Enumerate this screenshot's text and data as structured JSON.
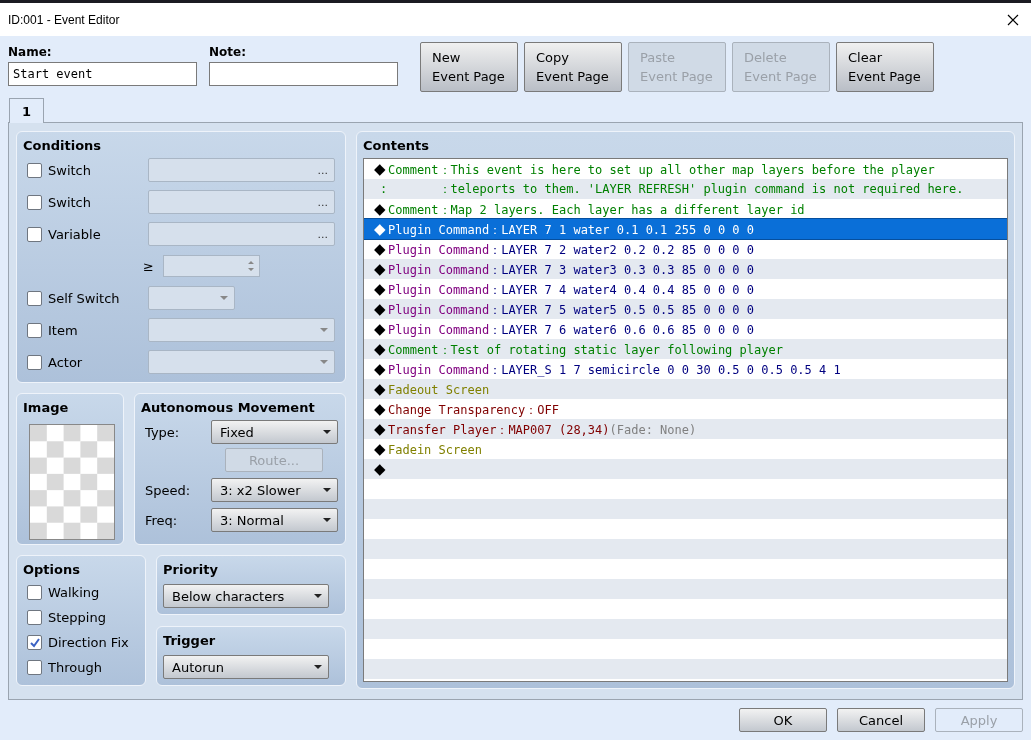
{
  "window": {
    "title": "ID:001 - Event Editor"
  },
  "name": {
    "label": "Name:",
    "value": "Start event"
  },
  "note": {
    "label": "Note:"
  },
  "page_buttons": [
    {
      "label": "New\nEvent Page",
      "disabled": false
    },
    {
      "label": "Copy\nEvent Page",
      "disabled": false
    },
    {
      "label": "Paste\nEvent Page",
      "disabled": true
    },
    {
      "label": "Delete\nEvent Page",
      "disabled": true
    },
    {
      "label": "Clear\nEvent Page",
      "disabled": false
    }
  ],
  "tabs": [
    {
      "label": "1",
      "selected": true
    }
  ],
  "conditions": {
    "title": "Conditions",
    "items": [
      {
        "kind": "browse",
        "label": "Switch",
        "checked": false,
        "button": "..."
      },
      {
        "kind": "browse",
        "label": "Switch",
        "checked": false,
        "button": "..."
      },
      {
        "kind": "browse",
        "label": "Variable",
        "checked": false,
        "button": "..."
      },
      {
        "kind": "compare",
        "symbol": "≥"
      },
      {
        "kind": "small_dropdown",
        "label": "Self Switch",
        "checked": false
      },
      {
        "kind": "dropdown",
        "label": "Item",
        "checked": false
      },
      {
        "kind": "dropdown",
        "label": "Actor",
        "checked": false
      }
    ]
  },
  "image": {
    "title": "Image"
  },
  "movement": {
    "title": "Autonomous Movement",
    "type_label": "Type:",
    "type": "Fixed",
    "route_button": {
      "label": "Route...",
      "disabled": true
    },
    "speed_label": "Speed:",
    "speed": "3: x2 Slower",
    "freq_label": "Freq:",
    "freq": "3: Normal"
  },
  "options": {
    "title": "Options",
    "items": [
      {
        "label": "Walking",
        "checked": false
      },
      {
        "label": "Stepping",
        "checked": false
      },
      {
        "label": "Direction Fix",
        "checked": true
      },
      {
        "label": "Through",
        "checked": false
      }
    ]
  },
  "priority": {
    "title": "Priority",
    "value": "Below characters"
  },
  "trigger": {
    "title": "Trigger",
    "value": "Autorun"
  },
  "contents": {
    "title": "Contents",
    "rows": [
      {
        "kind": "comment",
        "marker": "◆",
        "label": "Comment",
        "sep": "：",
        "args": "This event is here to set up all other map layers before the player",
        "selected": false
      },
      {
        "kind": "comment",
        "label": ":",
        "sep": "：",
        "args": "teleports to them. 'LAYER REFRESH' plugin command is not required here.",
        "selected": false
      },
      {
        "kind": "comment",
        "marker": "◆",
        "label": "Comment",
        "sep": "：",
        "args": "Map 2 layers. Each layer has a different layer id",
        "selected": false
      },
      {
        "kind": "plugin",
        "marker": "◆",
        "label": "Plugin Command",
        "sep": "：",
        "args": "LAYER 7 1 water 0.1 0.1 255 0 0 0 0",
        "selected": true
      },
      {
        "kind": "plugin",
        "marker": "◆",
        "label": "Plugin Command",
        "sep": "：",
        "args": "LAYER 7 2 water2 0.2 0.2 85 0 0 0 0",
        "selected": false
      },
      {
        "kind": "plugin",
        "marker": "◆",
        "label": "Plugin Command",
        "sep": "：",
        "args": "LAYER 7 3 water3 0.3 0.3 85 0 0 0 0",
        "selected": false
      },
      {
        "kind": "plugin",
        "marker": "◆",
        "label": "Plugin Command",
        "sep": "：",
        "args": "LAYER 7 4 water4 0.4 0.4 85 0 0 0 0",
        "selected": false
      },
      {
        "kind": "plugin",
        "marker": "◆",
        "label": "Plugin Command",
        "sep": "：",
        "args": "LAYER 7 5 water5 0.5 0.5 85 0 0 0 0",
        "selected": false
      },
      {
        "kind": "plugin",
        "marker": "◆",
        "label": "Plugin Command",
        "sep": "：",
        "args": "LAYER 7 6 water6 0.6 0.6 85 0 0 0 0",
        "selected": false
      },
      {
        "kind": "comment",
        "marker": "◆",
        "label": "Comment",
        "sep": "：",
        "args": "Test of rotating static layer following player",
        "selected": false
      },
      {
        "kind": "plugin",
        "marker": "◆",
        "label": "Plugin Command",
        "sep": "：",
        "args": "LAYER_S 1 7 semicircle 0 0 30 0.5 0 0.5 0.5 4 1",
        "selected": false
      },
      {
        "kind": "screen",
        "marker": "◆",
        "label": "Fadeout Screen",
        "selected": false
      },
      {
        "kind": "character",
        "marker": "◆",
        "label": "Change Transparency",
        "sep": "：",
        "args": "OFF",
        "selected": false
      },
      {
        "kind": "character",
        "marker": "◆",
        "label": "Transfer Player",
        "sep": "：",
        "args": "MAP007 (28,34)",
        "extra": "(Fade: None)",
        "selected": false
      },
      {
        "kind": "screen",
        "marker": "◆",
        "label": "Fadein Screen",
        "selected": false
      },
      {
        "kind": "empty",
        "marker": "◆",
        "selected": false
      }
    ]
  },
  "dialog_buttons": [
    {
      "label": "OK",
      "disabled": false
    },
    {
      "label": "Cancel",
      "disabled": false
    },
    {
      "label": "Apply",
      "disabled": true
    }
  ]
}
